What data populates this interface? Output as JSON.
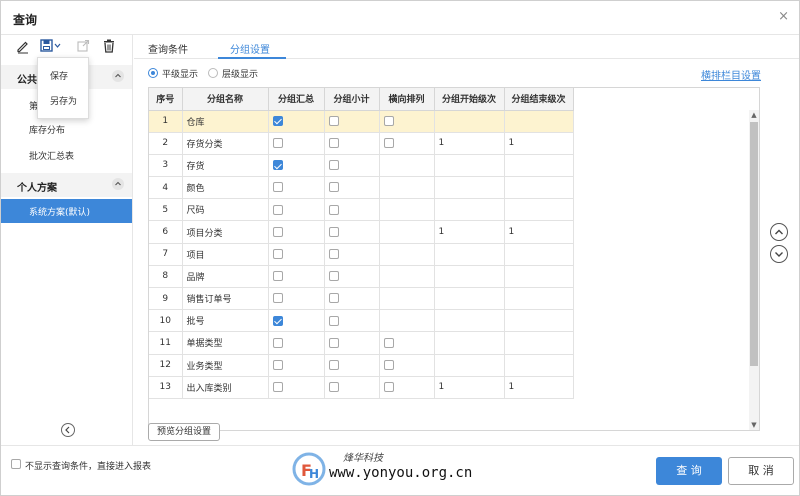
{
  "dialog": {
    "title": "查询",
    "close_label": "×"
  },
  "toolbar": {
    "icons": [
      "edit-icon",
      "save-icon",
      "export-icon",
      "delete-icon"
    ],
    "save_menu": [
      "保存",
      "另存为"
    ]
  },
  "sidebar": {
    "public_label": "公共",
    "public_items": [
      "库存分布",
      "批次汇总表"
    ],
    "personal_label": "个人方案",
    "personal_items": [
      {
        "label": "系统方案(默认)",
        "active": true
      }
    ]
  },
  "tabs": [
    {
      "label": "查询条件",
      "active": false
    },
    {
      "label": "分组设置",
      "active": true
    }
  ],
  "display_mode": {
    "options": [
      "平级显示",
      "层级显示"
    ],
    "selected": "平级显示"
  },
  "layout_link": "横排栏目设置",
  "grid": {
    "columns": [
      "序号",
      "分组名称",
      "分组汇总",
      "分组小计",
      "横向排列",
      "分组开始级次",
      "分组结束级次"
    ],
    "rows": [
      {
        "seq": "1",
        "name": "仓库",
        "sum": true,
        "sub": false,
        "hz": false,
        "start": "",
        "end": "",
        "highlight": true
      },
      {
        "seq": "2",
        "name": "存货分类",
        "sum": false,
        "sub": false,
        "hz": false,
        "start": "1",
        "end": "1",
        "highlight": false
      },
      {
        "seq": "3",
        "name": "存货",
        "sum": true,
        "sub": false,
        "hz": null,
        "start": "",
        "end": "",
        "highlight": false
      },
      {
        "seq": "4",
        "name": "颜色",
        "sum": false,
        "sub": false,
        "hz": null,
        "start": "",
        "end": "",
        "highlight": false
      },
      {
        "seq": "5",
        "name": "尺码",
        "sum": false,
        "sub": false,
        "hz": null,
        "start": "",
        "end": "",
        "highlight": false
      },
      {
        "seq": "6",
        "name": "项目分类",
        "sum": false,
        "sub": false,
        "hz": null,
        "start": "1",
        "end": "1",
        "highlight": false
      },
      {
        "seq": "7",
        "name": "项目",
        "sum": false,
        "sub": false,
        "hz": null,
        "start": "",
        "end": "",
        "highlight": false
      },
      {
        "seq": "8",
        "name": "品牌",
        "sum": false,
        "sub": false,
        "hz": null,
        "start": "",
        "end": "",
        "highlight": false
      },
      {
        "seq": "9",
        "name": "销售订单号",
        "sum": false,
        "sub": false,
        "hz": null,
        "start": "",
        "end": "",
        "highlight": false
      },
      {
        "seq": "10",
        "name": "批号",
        "sum": true,
        "sub": false,
        "hz": null,
        "start": "",
        "end": "",
        "highlight": false
      },
      {
        "seq": "11",
        "name": "单据类型",
        "sum": false,
        "sub": false,
        "hz": false,
        "start": "",
        "end": "",
        "highlight": false
      },
      {
        "seq": "12",
        "name": "业务类型",
        "sum": false,
        "sub": false,
        "hz": false,
        "start": "",
        "end": "",
        "highlight": false
      },
      {
        "seq": "13",
        "name": "出入库类别",
        "sum": false,
        "sub": false,
        "hz": false,
        "start": "1",
        "end": "1",
        "highlight": false
      }
    ]
  },
  "preset_button": "预览分组设置",
  "footer": {
    "skip_label": "不显示查询条件，直接进入报表",
    "query_label": "查 询",
    "cancel_label": "取 消"
  },
  "watermark": {
    "brand": "烽华科技",
    "url": "www.yonyou.org.cn"
  },
  "colors": {
    "accent": "#3d87d9",
    "highlight_row": "#fdf3d0"
  }
}
